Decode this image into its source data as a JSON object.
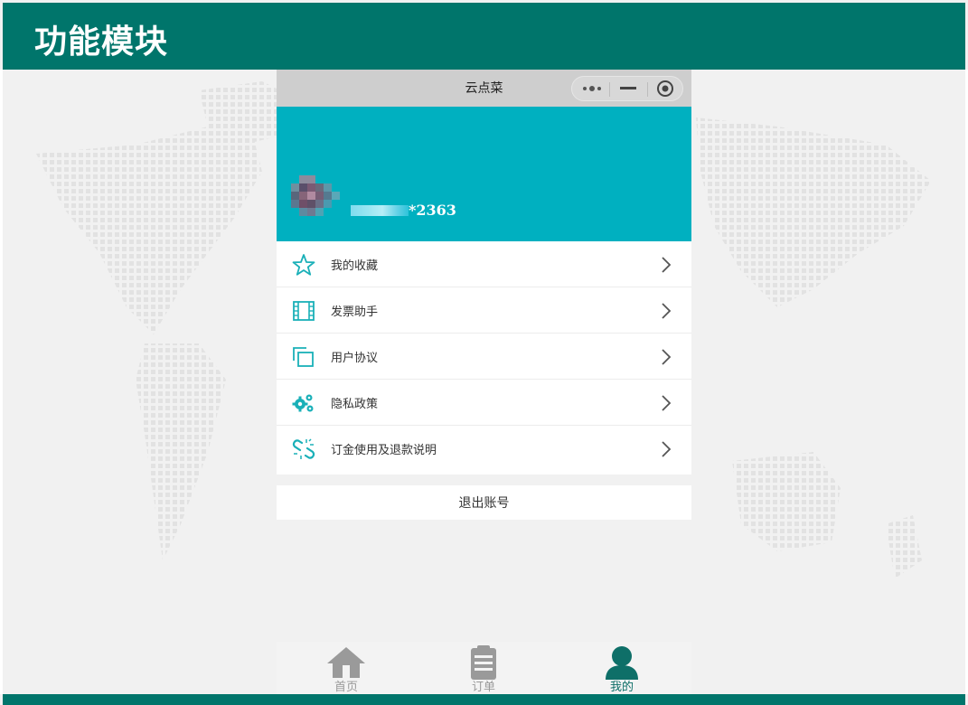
{
  "slide": {
    "title": "功能模块"
  },
  "phone": {
    "app_title": "云点菜",
    "capsule": {
      "more_icon": "more-dots-icon",
      "minimize_icon": "minimize-icon",
      "close_icon": "target-close-icon"
    },
    "profile": {
      "avatar_icon": "pixelated-avatar",
      "phone_suffix": "*2363"
    },
    "menu": [
      {
        "label": "我的收藏",
        "icon": "star-icon"
      },
      {
        "label": "发票助手",
        "icon": "film-invoice-icon"
      },
      {
        "label": "用户协议",
        "icon": "copy-pages-icon"
      },
      {
        "label": "隐私政策",
        "icon": "gears-icon"
      },
      {
        "label": "订金使用及退款说明",
        "icon": "broken-link-icon"
      }
    ],
    "logout_label": "退出账号",
    "tabs": [
      {
        "label": "首页",
        "icon": "home-icon",
        "active": false
      },
      {
        "label": "订单",
        "icon": "order-clipboard-icon",
        "active": false
      },
      {
        "label": "我的",
        "icon": "user-icon",
        "active": true
      }
    ]
  },
  "colors": {
    "header_green": "#00756b",
    "banner_teal": "#00b0c0",
    "icon_teal": "#1ab0b8",
    "tab_active": "#0e6f68",
    "tab_inactive": "#9a9a9a",
    "page_bg": "#f1f1f1"
  }
}
